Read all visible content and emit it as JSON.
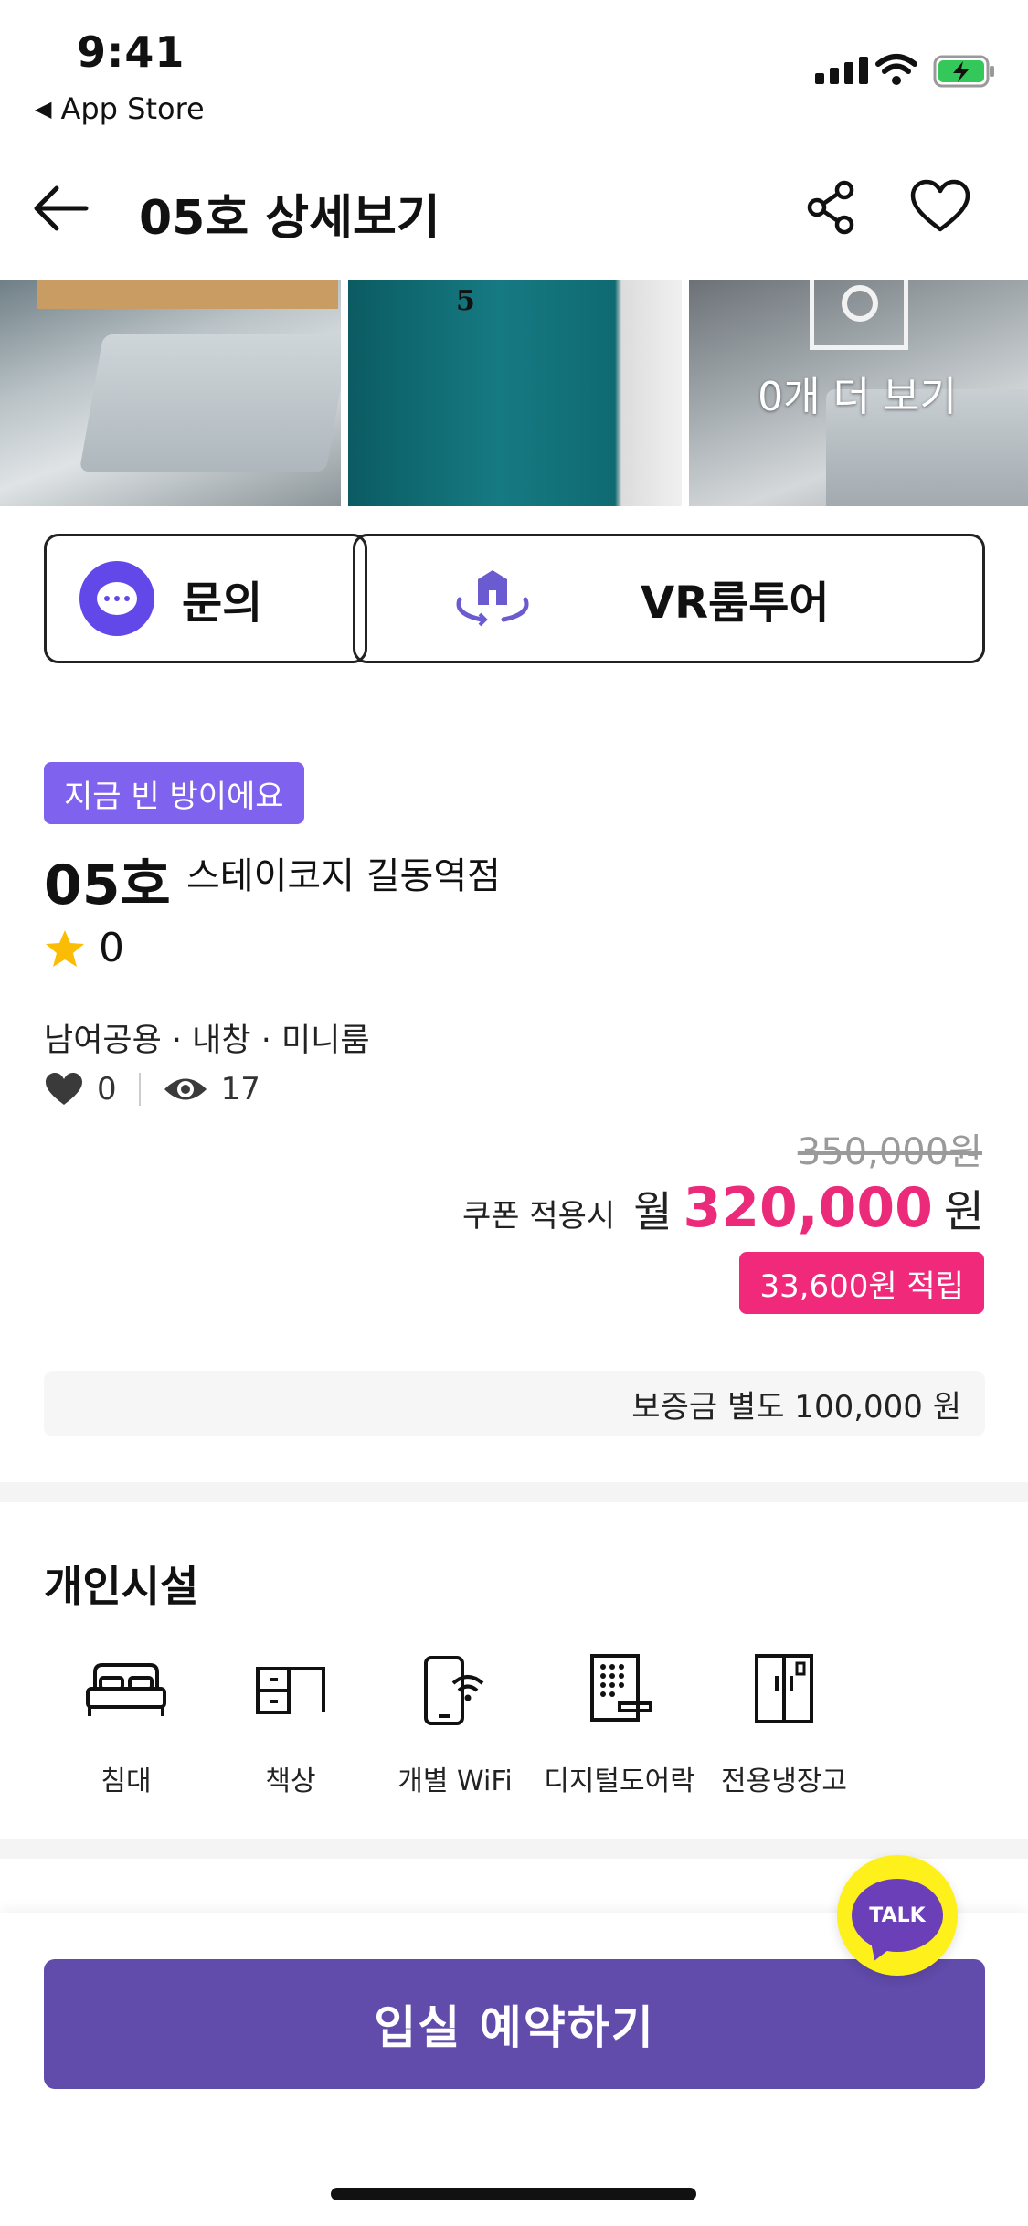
{
  "status_bar": {
    "time": "9:41",
    "back_app": "App Store"
  },
  "header": {
    "title": "05호 상세보기"
  },
  "photos": {
    "door_number": "5",
    "more_label": "0개 더 보기"
  },
  "actions": {
    "inquiry_label": "문의",
    "vr_label": "VR룸투어"
  },
  "room": {
    "vacancy_badge": "지금 빈 방이에요",
    "number": "05호",
    "branch": "스테이코지 길동역점",
    "rating": "0",
    "tags": "남여공용 · 내창 · 미니룸",
    "likes": "0",
    "views": "17"
  },
  "price": {
    "original": "350,000원",
    "coupon_label": "쿠폰 적용시",
    "period": "월",
    "amount": "320,000",
    "currency": "원",
    "points": "33,600원 적립",
    "deposit": "보증금 별도 100,000 원"
  },
  "facilities": {
    "title": "개인시설",
    "items": [
      {
        "label": "침대",
        "icon": "bed-icon"
      },
      {
        "label": "책상",
        "icon": "desk-icon"
      },
      {
        "label": "개별 WiFi",
        "icon": "phone-wifi-icon"
      },
      {
        "label": "디지털도어락",
        "icon": "door-lock-icon"
      },
      {
        "label": "전용냉장고",
        "icon": "fridge-icon"
      }
    ]
  },
  "bottom": {
    "reserve_label": "입실 예약하기",
    "talk_label": "TALK"
  },
  "colors": {
    "accent_purple": "#614bab",
    "badge_purple": "#7f62ee",
    "price_pink": "#ec2a7a",
    "kakao_yellow": "#fef01b"
  }
}
